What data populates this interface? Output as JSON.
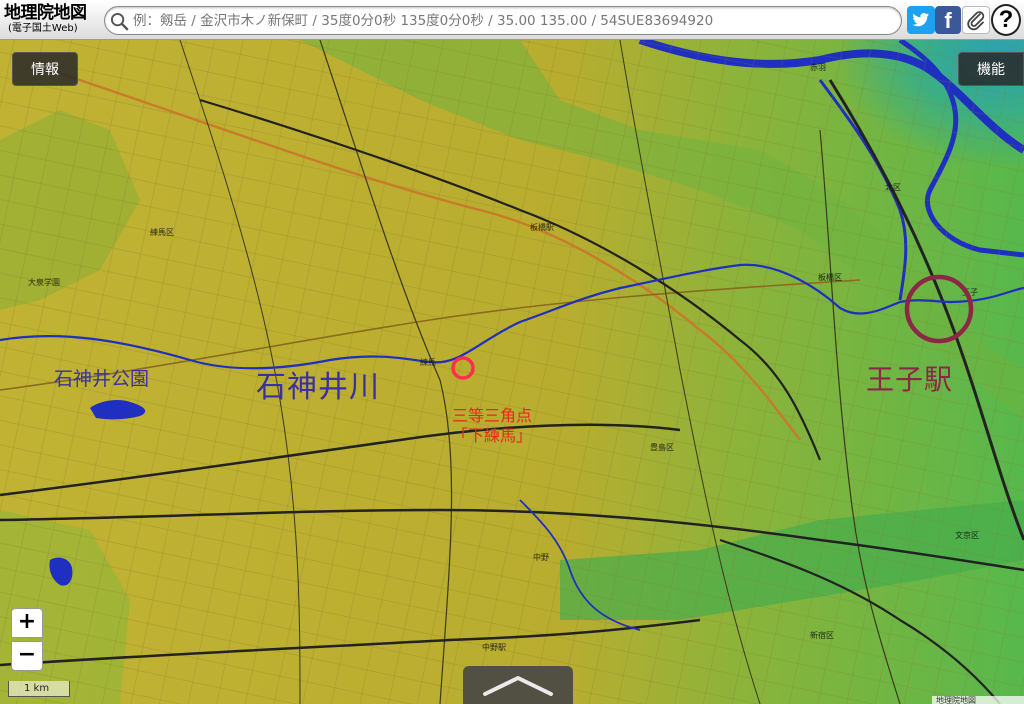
{
  "header": {
    "logo_title": "地理院地図",
    "logo_subtitle": "(電子国土Web)",
    "search_placeholder": "例：剱岳 / 金沢市木ノ新保町 / 35度0分0秒 135度0分0秒 / 35.00 135.00 / 54SUE83694920"
  },
  "buttons": {
    "info": "情報",
    "functions": "機能",
    "zoom_in": "+",
    "zoom_out": "−",
    "help": "?",
    "facebook": "f"
  },
  "scale_bar": "1 km",
  "annotations": {
    "park": "石神井公園",
    "river": "石神井川",
    "triangulation_line1": "三等三角点",
    "triangulation_line2": "「下練馬」",
    "station": "王子駅"
  },
  "map_labels": [
    "練馬区",
    "北区",
    "豊島区",
    "板橋区",
    "文京区",
    "新宿区",
    "中野",
    "大泉学園",
    "練馬",
    "王子",
    "赤羽",
    "板橋駅",
    "中野駅"
  ],
  "attribution": "地理院地図",
  "colors": {
    "terrain_low": "#2b8fd0",
    "terrain_mid": "#3db053",
    "terrain_high": "#c8b42a",
    "river": "#1f2fbf",
    "rail": "#222222",
    "major_road": "#c97a2a",
    "river_label": "#3a2fa6",
    "triangulation_point": "#ff2e4e",
    "station_circle": "#8c2845"
  }
}
